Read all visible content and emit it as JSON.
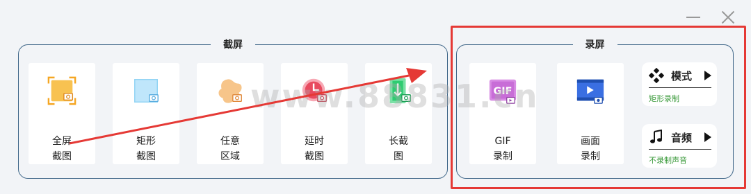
{
  "window": {
    "minimize_icon": "minimize-icon",
    "close_icon": "close-icon"
  },
  "screenshot_group": {
    "title": "截屏",
    "items": [
      {
        "line1": "全屏",
        "line2": "截图",
        "icon": "fullscreen-capture-icon",
        "color": "#f5a623"
      },
      {
        "line1": "矩形",
        "line2": "截图",
        "icon": "rectangle-capture-icon",
        "color": "#8fd3f4"
      },
      {
        "line1": "任意",
        "line2": "区域",
        "icon": "freeform-capture-icon",
        "color": "#f7b267"
      },
      {
        "line1": "延时",
        "line2": "截图",
        "icon": "delayed-capture-icon",
        "color": "#e84a5f"
      },
      {
        "line1": "长截",
        "line2": "图",
        "icon": "long-capture-icon",
        "color": "#2ecc71"
      }
    ]
  },
  "record_group": {
    "title": "录屏",
    "items": [
      {
        "line1": "GIF",
        "line2": "录制",
        "icon": "gif-record-icon",
        "icon_text": "GIF",
        "color": "#c86dd7"
      },
      {
        "line1": "画面",
        "line2": "录制",
        "icon": "video-record-icon",
        "color": "#3a6fe2"
      }
    ],
    "mode": {
      "label": "模式",
      "sub": "矩形录制",
      "icon": "mode-diamond-icon"
    },
    "audio": {
      "label": "音频",
      "sub": "不录制声音",
      "icon": "music-note-icon"
    }
  },
  "watermark": "www.88831.cn",
  "annotation": {
    "highlight_color": "#e53935",
    "arrow_color": "#e53935"
  }
}
